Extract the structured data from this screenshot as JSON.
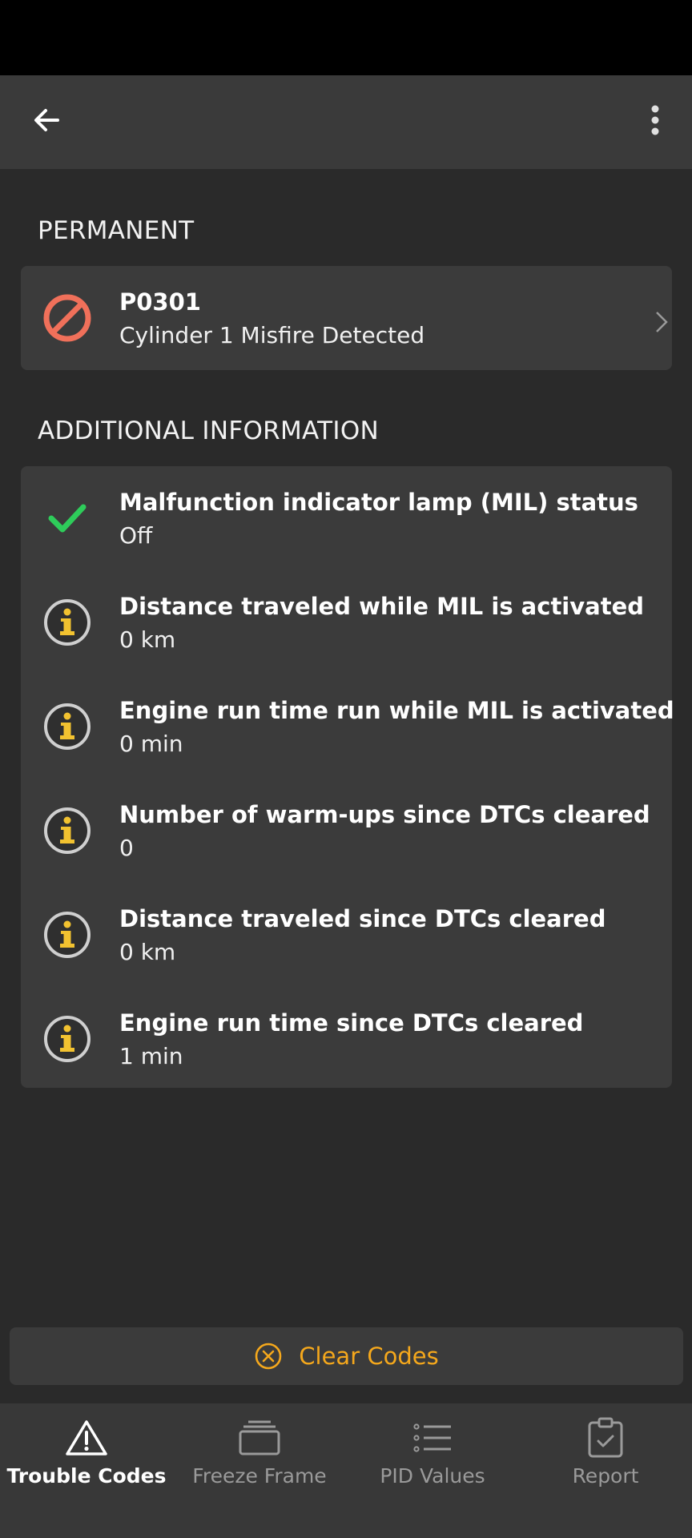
{
  "sections": {
    "permanent_title": "PERMANENT",
    "additional_title": "ADDITIONAL INFORMATION"
  },
  "dtc": {
    "code": "P0301",
    "description": "Cylinder 1 Misfire Detected",
    "icon": "prohibited-icon"
  },
  "info_rows": [
    {
      "title": "Malfunction indicator lamp (MIL) status",
      "value": "Off",
      "icon": "check-icon"
    },
    {
      "title": "Distance traveled while MIL is activated",
      "value": "0 km",
      "icon": "info-icon"
    },
    {
      "title": "Engine run time run while MIL is activated",
      "value": "0 min",
      "icon": "info-icon"
    },
    {
      "title": "Number of warm-ups since DTCs cleared",
      "value": "0",
      "icon": "info-icon"
    },
    {
      "title": "Distance traveled since DTCs cleared",
      "value": "0 km",
      "icon": "info-icon"
    },
    {
      "title": "Engine run time since DTCs cleared",
      "value": "1 min",
      "icon": "info-icon"
    }
  ],
  "actions": {
    "clear_codes": "Clear Codes"
  },
  "nav": [
    {
      "label": "Trouble Codes",
      "icon": "warning-triangle-icon",
      "active": true
    },
    {
      "label": "Freeze Frame",
      "icon": "layers-icon",
      "active": false
    },
    {
      "label": "PID Values",
      "icon": "list-icon",
      "active": false
    },
    {
      "label": "Report",
      "icon": "clipboard-check-icon",
      "active": false
    }
  ],
  "colors": {
    "background": "#2a2a2a",
    "card": "#3b3b3b",
    "accent": "#f5a81c",
    "error": "#f0705a",
    "success": "#2ecc5a",
    "info_yellow": "#f2c230"
  }
}
